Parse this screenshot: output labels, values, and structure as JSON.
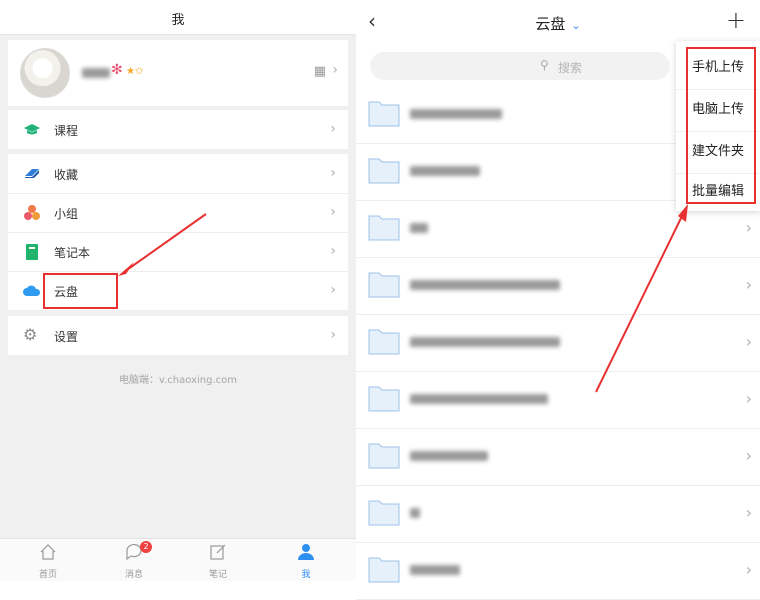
{
  "left": {
    "title": "我",
    "profile": {
      "stars": "★✩"
    },
    "menu_group1": [
      {
        "label": "课程",
        "icon": "graduation-cap-icon"
      }
    ],
    "menu_group2": [
      {
        "label": "收藏",
        "icon": "bookmark-icon"
      },
      {
        "label": "小组",
        "icon": "group-icon"
      },
      {
        "label": "笔记本",
        "icon": "notebook-icon"
      },
      {
        "label": "云盘",
        "icon": "cloud-icon"
      }
    ],
    "menu_group3": [
      {
        "label": "设置",
        "icon": "gear-icon"
      }
    ],
    "footer_note": "电脑端：v.chaoxing.com",
    "tabs": [
      {
        "label": "首页",
        "icon": "home-icon"
      },
      {
        "label": "消息",
        "icon": "chat-icon",
        "badge": "2"
      },
      {
        "label": "笔记",
        "icon": "edit-icon"
      },
      {
        "label": "我",
        "icon": "person-icon"
      }
    ]
  },
  "right": {
    "title": "云盘",
    "search": {
      "placeholder": "搜索"
    },
    "menu": [
      "手机上传",
      "电脑上传",
      "建文件夹",
      "批量编辑"
    ],
    "folders": [
      {
        "name": ""
      },
      {
        "name": ""
      },
      {
        "name": ""
      },
      {
        "name": ""
      },
      {
        "name": ""
      },
      {
        "name": ""
      },
      {
        "name": ""
      },
      {
        "name": ""
      },
      {
        "name": ""
      }
    ]
  },
  "colors": {
    "accent": "#2f8ff0",
    "highlight": "#e83030",
    "folder": "#e6f0fb"
  }
}
